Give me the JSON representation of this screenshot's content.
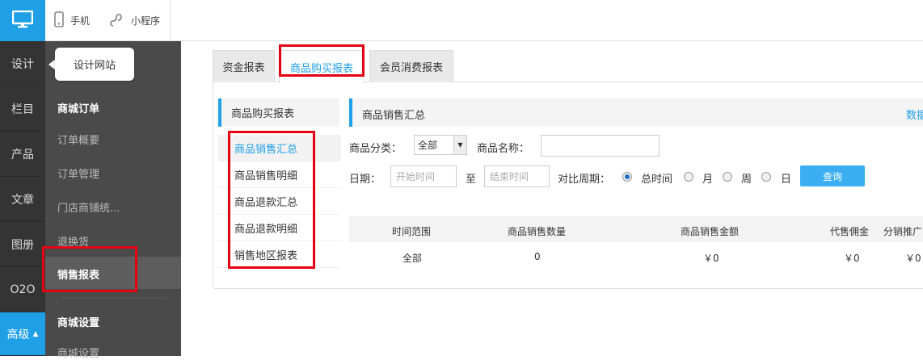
{
  "topbar": {
    "items": [
      {
        "label": "手机",
        "icon": "phone-icon"
      },
      {
        "label": "小程序",
        "icon": "miniprogram-icon"
      }
    ],
    "logo_icon": "monitor-icon"
  },
  "left_column": {
    "items": [
      "设计",
      "栏目",
      "产品",
      "文章",
      "图册",
      "O2O",
      "高级"
    ],
    "active": "高级"
  },
  "tooltip": {
    "text": "设计网站"
  },
  "nav": {
    "section1": "商城订单",
    "items": [
      "订单概要",
      "订单管理",
      "门店商铺统...",
      "退换货",
      "销售报表"
    ],
    "active": "销售报表",
    "section2": "商城设置",
    "section2_item": "商城设置"
  },
  "tabs": [
    {
      "label": "资金报表"
    },
    {
      "label": "商品购买报表",
      "active": true
    },
    {
      "label": "会员消费报表"
    }
  ],
  "submenu": {
    "title": "商品购买报表",
    "items": [
      "商品销售汇总",
      "商品销售明细",
      "商品退款汇总",
      "商品退款明细",
      "销售地区报表"
    ],
    "active": "商品销售汇总"
  },
  "content": {
    "title": "商品销售汇总",
    "link_partial": "数据",
    "filters": {
      "category_label": "商品分类：",
      "category_value": "全部",
      "name_label": "商品名称：",
      "name_value": "",
      "date_label": "日期：",
      "start_placeholder": "开始时间",
      "to_label": "至",
      "end_placeholder": "结束时间",
      "period_label": "对比周期：",
      "period_options": [
        "总时间",
        "月",
        "周",
        "日"
      ],
      "period_selected": "总时间",
      "query_button": "查询"
    },
    "table": {
      "headers": [
        "时间范围",
        "商品销售数量",
        "商品销售金额",
        "代售佣金",
        "分销推广"
      ],
      "rows": [
        [
          "全部",
          "0",
          "￥0",
          "￥0",
          "￥0"
        ]
      ]
    }
  },
  "colors": {
    "accent": "#1e9fe6",
    "highlight": "#e60012",
    "nav_bg": "#4a4a4a",
    "left_bg": "#343434"
  }
}
